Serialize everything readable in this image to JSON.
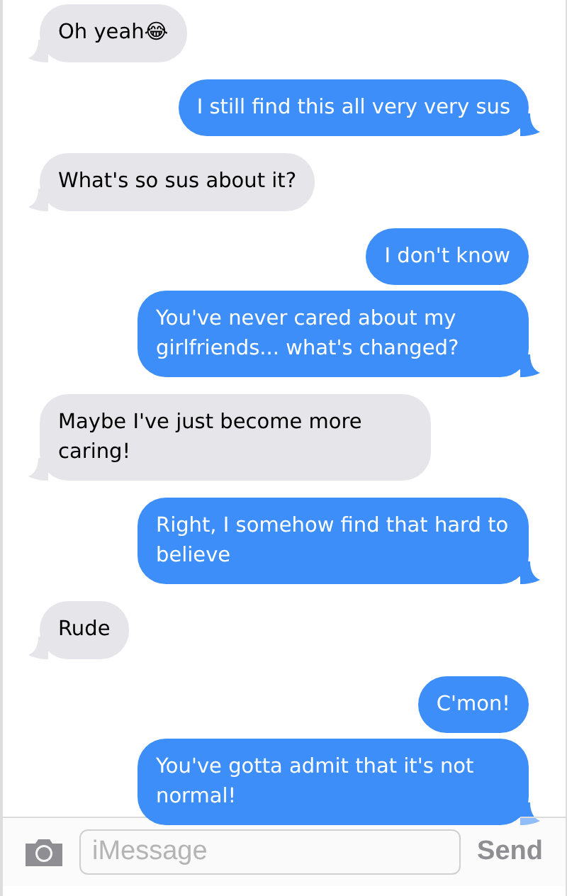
{
  "messages": [
    {
      "kind": "received",
      "text": "Oh yeah😂"
    },
    {
      "kind": "sent",
      "text": "I still find this all very very sus"
    },
    {
      "kind": "received",
      "text": "What's so sus about it?"
    },
    {
      "kind": "sent",
      "text": "I don't know"
    },
    {
      "kind": "sent",
      "text": "You've never cared about my girlfriends... what's changed?"
    },
    {
      "kind": "received",
      "text": "Maybe I've just become more caring!"
    },
    {
      "kind": "sent",
      "text": "Right, I somehow find that hard to believe"
    },
    {
      "kind": "received",
      "text": "Rude"
    },
    {
      "kind": "sent",
      "text": "C'mon!"
    },
    {
      "kind": "sent",
      "text": "You've gotta admit that it's not normal!"
    }
  ],
  "composer": {
    "placeholder": "iMessage",
    "send": "Send"
  }
}
